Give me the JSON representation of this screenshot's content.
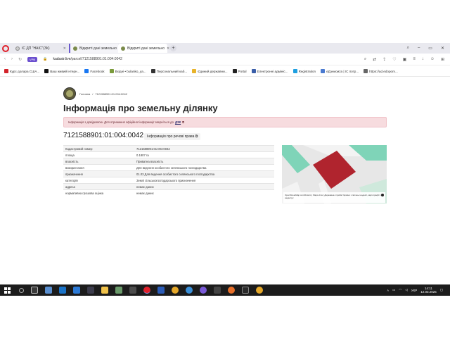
{
  "tabs": [
    {
      "label": "IC ДП \"НАІС\"(ЗК)",
      "active": false
    },
    {
      "label": "Відкриті дані земельно",
      "active": false
    },
    {
      "label": "Відкриті дані земельно",
      "active": true
    }
  ],
  "address": {
    "host": "kadastr.live",
    "path": "/parcel/7121588901:01:004:0042",
    "vpn_label": "VPN"
  },
  "bookmarks": [
    "Курс долара США...",
    "Ваш живий інтерн...",
    "Facebook",
    "Вхідні • bulanko_ya...",
    "Персональний каб...",
    "Єдиний державни...",
    "Portal",
    "Електронні адмініс...",
    "Registration",
    "еДзниоиzа | IC потр...",
    "https://ad.edopom..."
  ],
  "page": {
    "crumb_home": "Головна",
    "crumb_sep": "/",
    "crumb_current": "7121588901:01:004:0042",
    "title": "Інформація про земельну ділянку",
    "alert_text": "Інформація з довідковою. Для отримання офіційної інформації зверніться до",
    "alert_link": "ДЗК",
    "cadnum": "7121588901:01:004:0042",
    "rights_label": "Інформація про речові права"
  },
  "props": [
    {
      "k": "Кадастровий номер",
      "v": "7121588901:01:004:0042"
    },
    {
      "k": "площа",
      "v": "0.1807 га"
    },
    {
      "k": "власність",
      "v": "Приватна власність"
    },
    {
      "k": "використання",
      "v": "Для ведення особистого селянського господарства"
    },
    {
      "k": "призначення",
      "v": "01.03 Для ведення особистого селянського господарства"
    },
    {
      "k": "категорія",
      "v": "Землі сільськогосподарського призначення"
    },
    {
      "k": "адреса",
      "v": "немає даних"
    },
    {
      "k": "нормативна грошова оцінка",
      "v": "немає даних"
    }
  ],
  "map": {
    "attribution": "OpenStreetMap contributors | Maps.dms | Державна служба України з питань геодезії, картографії та кадастру",
    "parcel_color": "#b0242e",
    "green_color": "#7fd4b8"
  },
  "taskbar": {
    "time": "14:11",
    "date": "12.03.2025",
    "lang": "УКР"
  }
}
